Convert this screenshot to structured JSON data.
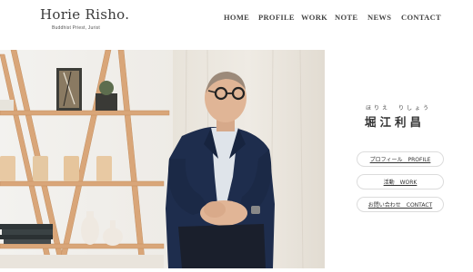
{
  "site": {
    "logo_title": "Horie Risho.",
    "logo_subtitle": "Buddhist Priest, Jurist"
  },
  "nav": {
    "items": [
      {
        "label": "HOME"
      },
      {
        "label": "PROFILE"
      },
      {
        "label": "WORK"
      },
      {
        "label": "NOTE"
      },
      {
        "label": "NEWS"
      },
      {
        "label": "CONTACT"
      }
    ]
  },
  "profile": {
    "name_ruby": "ほりえ　りしょう",
    "name_kanji": "堀江利昌"
  },
  "links": [
    {
      "label": "プロフィール　PROFILE"
    },
    {
      "label": "活動　WORK"
    },
    {
      "label": "お問い合わせ　CONTACT"
    }
  ],
  "colors": {
    "text": "#333333",
    "pill_border": "#dcdcdc",
    "shelf_wood": "#d9a679",
    "jacket": "#1e2d4d"
  }
}
